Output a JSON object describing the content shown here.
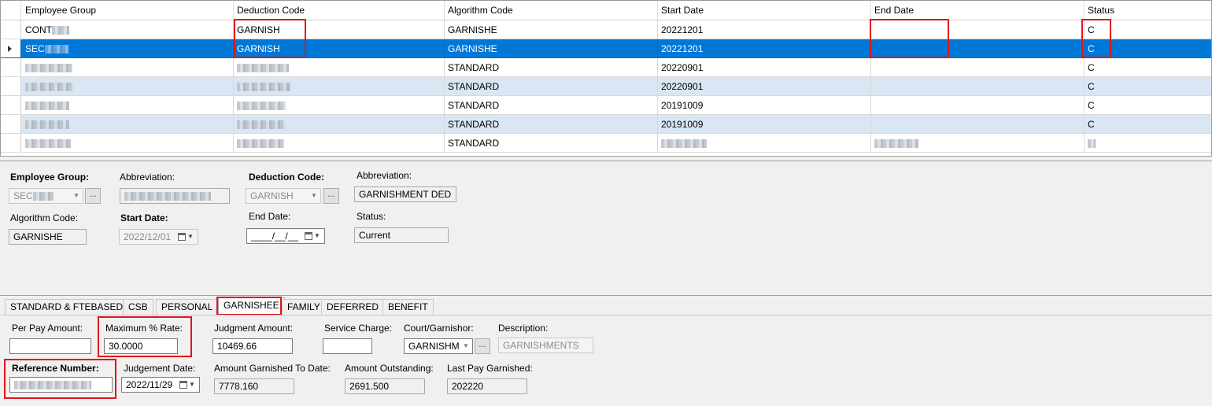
{
  "grid": {
    "columns": [
      "Employee Group",
      "Deduction Code",
      "Algorithm Code",
      "Start Date",
      "End Date",
      "Status"
    ],
    "rows": [
      {
        "group": "CONT",
        "deduction": "GARNISH",
        "algorithm": "GARNISHE",
        "start": "20221201",
        "end": "",
        "status": "C"
      },
      {
        "group": "SEC",
        "deduction": "GARNISH",
        "algorithm": "GARNISHE",
        "start": "20221201",
        "end": "",
        "status": "C"
      },
      {
        "group": "",
        "deduction": "",
        "algorithm": "STANDARD",
        "start": "20220901",
        "end": "",
        "status": "C"
      },
      {
        "group": "",
        "deduction": "",
        "algorithm": "STANDARD",
        "start": "20220901",
        "end": "",
        "status": "C"
      },
      {
        "group": "",
        "deduction": "",
        "algorithm": "STANDARD",
        "start": "20191009",
        "end": "",
        "status": "C"
      },
      {
        "group": "",
        "deduction": "",
        "algorithm": "STANDARD",
        "start": "20191009",
        "end": "",
        "status": "C"
      },
      {
        "group": "",
        "deduction": "",
        "algorithm": "STANDARD",
        "start": "",
        "end": "",
        "status": ""
      }
    ]
  },
  "detail": {
    "employee_group_label": "Employee Group:",
    "employee_group_value": "SEC",
    "abbreviation1_label": "Abbreviation:",
    "deduction_code_label": "Deduction Code:",
    "deduction_code_value": "GARNISH",
    "abbreviation2_label": "Abbreviation:",
    "abbreviation2_value": "GARNISHMENT DED",
    "algorithm_code_label": "Algorithm Code:",
    "algorithm_code_value": "GARNISHE",
    "start_date_label": "Start Date:",
    "start_date_value": "2022/12/01",
    "end_date_label": "End Date:",
    "end_date_value": "____/__/__",
    "status_label": "Status:",
    "status_value": "Current",
    "ellipsis": "..."
  },
  "tabs": [
    "STANDARD & FTEBASED",
    "CSB",
    "PERSONAL",
    "GARNISHEE",
    "FAMILY",
    "DEFERRED",
    "BENEFIT"
  ],
  "garnishee": {
    "per_pay_amount_label": "Per Pay Amount:",
    "per_pay_amount_value": "",
    "max_rate_label": "Maximum % Rate:",
    "max_rate_value": "30.0000",
    "judgment_amount_label": "Judgment Amount:",
    "judgment_amount_value": "10469.66",
    "service_charge_label": "Service Charge:",
    "service_charge_value": "",
    "court_label": "Court/Garnishor:",
    "court_value": "GARNISHM",
    "description_label": "Description:",
    "description_value": "GARNISHMENTS",
    "reference_number_label": "Reference Number:",
    "judgement_date_label": "Judgement Date:",
    "judgement_date_value": "2022/11/29",
    "garnished_to_date_label": "Amount Garnished To Date:",
    "garnished_to_date_value": "7778.160",
    "outstanding_label": "Amount Outstanding:",
    "outstanding_value": "2691.500",
    "last_pay_label": "Last Pay Garnished:",
    "last_pay_value": "202220"
  },
  "colors": {
    "selection": "#0078d7",
    "alt_row": "#dae6f3",
    "highlight": "#e0141b"
  }
}
